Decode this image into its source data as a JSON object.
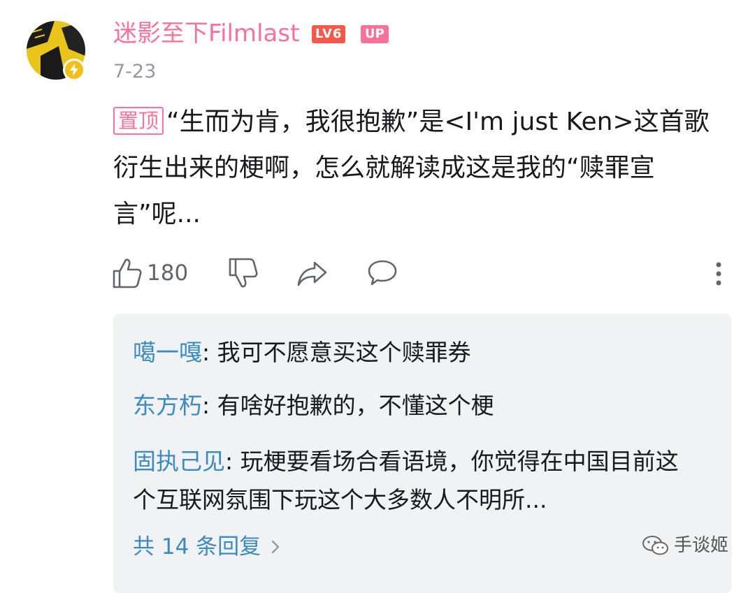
{
  "comment": {
    "username": "迷影至下Filmlast",
    "level_badge": "LV6",
    "up_badge": "UP",
    "date": "7-23",
    "pin_tag": "置顶",
    "text": "“生而为肯，我很抱歉”是<I'm just Ken>这首歌衍生出来的梗啊，怎么就解读成这是我的“赎罪宣言”呢...",
    "like_count": "180"
  },
  "replies": {
    "items": [
      {
        "name": "噶一嘎",
        "sep": ": ",
        "text": "我可不愿意买这个赎罪券"
      },
      {
        "name": "东方朽",
        "sep": ": ",
        "text": "有啥好抱歉的，不懂这个梗"
      },
      {
        "name": "固执己见",
        "sep": ": ",
        "text": "玩梗要看场合看语境，你觉得在中国目前这个互联网氛围下玩这个大多数人不明所..."
      }
    ],
    "more_label": "共 14 条回复"
  },
  "watermark": {
    "label": "手谈姬"
  },
  "colors": {
    "accent": "#fb7299",
    "reply_name": "#3a8bc1",
    "reply_bg": "#f1f2f3",
    "level": "#f55a4b"
  },
  "icons": [
    "avatar-image",
    "verified-lightning-icon",
    "thumbs-up-icon",
    "thumbs-down-icon",
    "share-icon",
    "comment-icon",
    "more-vertical-icon",
    "chevron-right-icon",
    "wechat-icon"
  ]
}
